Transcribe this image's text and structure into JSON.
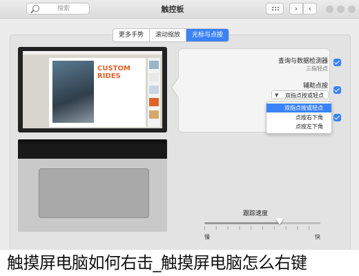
{
  "window": {
    "title": "触控板",
    "search_placeholder": "搜索"
  },
  "tabs": [
    {
      "label": "光标与点按",
      "active": true
    },
    {
      "label": "滚动缩放",
      "active": false
    },
    {
      "label": "更多手势",
      "active": false
    }
  ],
  "illustration": {
    "brand_line1": "CUSTOM",
    "brand_line2": "RIDES"
  },
  "options": {
    "lookup_label": "查询与数据检测器",
    "lookup_sub": "三指轻点",
    "secondary_label": "辅助点按",
    "secondary_value": "双指点按或轻点",
    "menu": [
      "双指点按或轻点",
      "点按右下角",
      "点按左下角"
    ],
    "menu_selected_index": 0
  },
  "speed": {
    "title": "跟踪速度",
    "left_label": "慢",
    "right_label": "快",
    "value_fraction": 0.65
  },
  "caption": "触摸屏电脑如何右击_触摸屏电脑怎么右键",
  "colors": {
    "accent": "#3b82f6"
  }
}
